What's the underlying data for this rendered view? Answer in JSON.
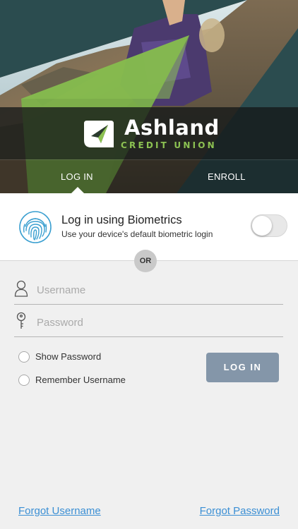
{
  "brand": {
    "name": "Ashland",
    "subtitle": "CREDIT UNION",
    "accent_color": "#8cc152"
  },
  "tabs": [
    {
      "label": "LOG IN",
      "active": true
    },
    {
      "label": "ENROLL",
      "active": false
    }
  ],
  "biometrics": {
    "title": "Log in using Biometrics",
    "description": "Use your device's default biometric login",
    "icon": "fingerprint-icon",
    "enabled": false
  },
  "divider": {
    "label": "OR"
  },
  "form": {
    "username": {
      "placeholder": "Username",
      "value": "",
      "icon": "user-icon"
    },
    "password": {
      "placeholder": "Password",
      "value": "",
      "icon": "key-icon"
    },
    "show_password": {
      "label": "Show Password",
      "checked": false
    },
    "remember_username": {
      "label": "Remember Username",
      "checked": false
    },
    "login_button": "LOG IN"
  },
  "links": {
    "forgot_username": "Forgot Username",
    "forgot_password": "Forgot Password"
  },
  "colors": {
    "button": "#8496a9",
    "link": "#3b8fd4",
    "fingerprint": "#3a9fd0"
  }
}
